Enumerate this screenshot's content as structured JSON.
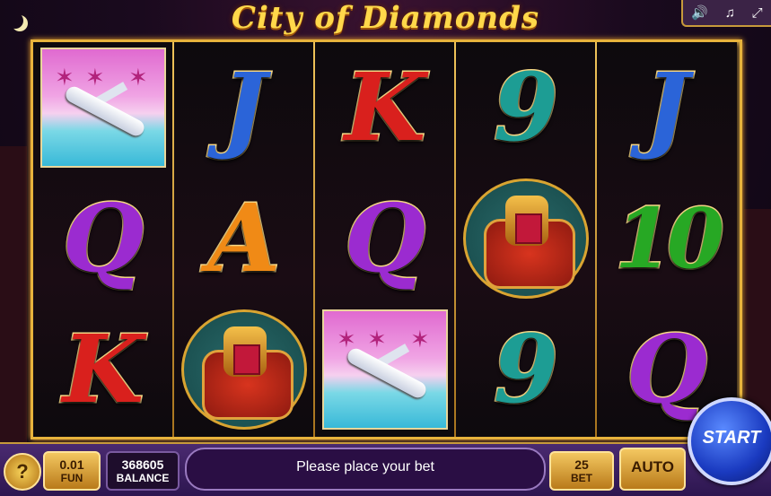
{
  "game": {
    "title": "City of Diamonds"
  },
  "top_controls": [
    {
      "name": "sound",
      "icon": "speaker-icon",
      "glyph": "🔊"
    },
    {
      "name": "music",
      "icon": "music-note-icon",
      "glyph": "♫"
    },
    {
      "name": "fullscreen",
      "icon": "fullscreen-icon",
      "glyph": "⤢"
    }
  ],
  "reels": [
    [
      "jet",
      "Q",
      "K"
    ],
    [
      "J",
      "A",
      "ring"
    ],
    [
      "K",
      "Q",
      "jet"
    ],
    [
      "9",
      "ring",
      "9"
    ],
    [
      "J",
      "10",
      "Q"
    ]
  ],
  "footer": {
    "help_label": "?",
    "coin_value": "0.01",
    "coin_label": "FUN",
    "balance_value": "368605",
    "balance_label": "BALANCE",
    "message": "Please place your bet",
    "bet_value": "25",
    "bet_label": "BET",
    "auto_label": "AUTO",
    "start_label": "START"
  },
  "colors": {
    "frame_gold": "#e7b33c",
    "start_blue": "#1a3ac0",
    "panel_purple": "#4a2a70"
  }
}
